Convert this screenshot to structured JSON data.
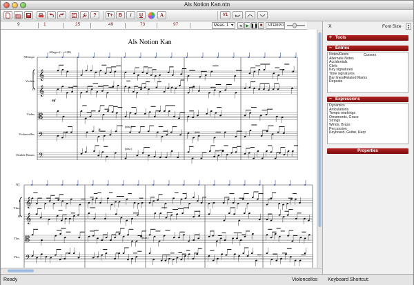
{
  "window": {
    "title": "Als Notion Kan.ntn"
  },
  "toolbar": {
    "buttons": [
      {
        "name": "new-document-button",
        "glyph": "",
        "icon": "new-document-icon"
      },
      {
        "name": "open-button",
        "glyph": "",
        "icon": "folder-icon"
      },
      {
        "name": "save-button",
        "glyph": "",
        "icon": "save-icon"
      },
      {
        "name": "print-button",
        "glyph": "",
        "icon": "printer-icon"
      },
      {
        "name": "undo-button",
        "glyph": "",
        "icon": "undo-icon"
      },
      {
        "name": "redo-button",
        "glyph": "",
        "icon": "redo-icon"
      },
      {
        "name": "info-button",
        "glyph": "",
        "icon": "info-icon"
      },
      {
        "name": "wrench-button",
        "glyph": "",
        "icon": "wrench-icon"
      },
      {
        "name": "help-button",
        "glyph": "?",
        "icon": "help-icon"
      },
      {
        "name": "text-size-button",
        "glyph": "T+",
        "icon": "text-size-icon"
      },
      {
        "name": "bold-button",
        "glyph": "B",
        "icon": "bold-icon"
      },
      {
        "name": "italic-button",
        "glyph": "i",
        "icon": "italic-icon"
      },
      {
        "name": "underline-button",
        "glyph": "U",
        "icon": "underline-icon"
      },
      {
        "name": "color-button",
        "glyph": "",
        "icon": "color-wheel-icon"
      },
      {
        "name": "font-button",
        "glyph": "A",
        "icon": "font-icon"
      },
      {
        "name": "voice-button",
        "glyph": "V1",
        "icon": "voice-icon"
      },
      {
        "name": "tie-button",
        "glyph": "",
        "icon": "tie-icon"
      },
      {
        "name": "slur-up-button",
        "glyph": "",
        "icon": "slur-up-icon"
      },
      {
        "name": "slur-down-button",
        "glyph": "",
        "icon": "slur-down-icon"
      }
    ]
  },
  "ruler": {
    "numbers": [
      "9",
      "1",
      "25",
      "49",
      "73",
      "97"
    ],
    "measure_label": "Meas. 1",
    "tempo_label": "NTEMPO"
  },
  "score": {
    "title": "Als Notion Kan",
    "tempo_marking": "Allegro (♩=100)",
    "system1_labels": [
      "NTempo",
      "I",
      "Violins",
      "II",
      "Violas",
      "Violoncellos",
      "Double Basses"
    ],
    "system2_labels": [
      "NT",
      "I",
      "Vlns.",
      "II",
      "Vlas.",
      "Vlcs."
    ],
    "dynamics": [
      "mf",
      "p",
      "(pizz.)",
      "(pizz.)",
      "(pizz.)"
    ]
  },
  "panel": {
    "x_label": "X",
    "font_size_label": "Font Size",
    "sections": {
      "tools": "Tools",
      "entries": "Entries",
      "expressions": "Expressions",
      "properties": "Properties"
    },
    "entries_items": [
      "Notes/Rests",
      "Alternate Notes",
      "Accidentals",
      "Clefs",
      "Key signatures",
      "Time signatures",
      "Bar lines/Related Marks",
      "Repeats"
    ],
    "entries_col2": "Cursors",
    "expressions_items": [
      "Dynamics",
      "Articulations",
      "Tempo markings",
      "Ornaments, Grace",
      "Strings",
      "Winds, Brass",
      "Percussion",
      "Keyboard, Guitar, Harp"
    ]
  },
  "status": {
    "left": "Ready",
    "middle": "Violoncellos",
    "right": "Keyboard Shortcut:"
  },
  "colors": {
    "accent": "#8b1e1e",
    "section_header": "#a01818",
    "scroll_thumb": "#8fb0de"
  }
}
